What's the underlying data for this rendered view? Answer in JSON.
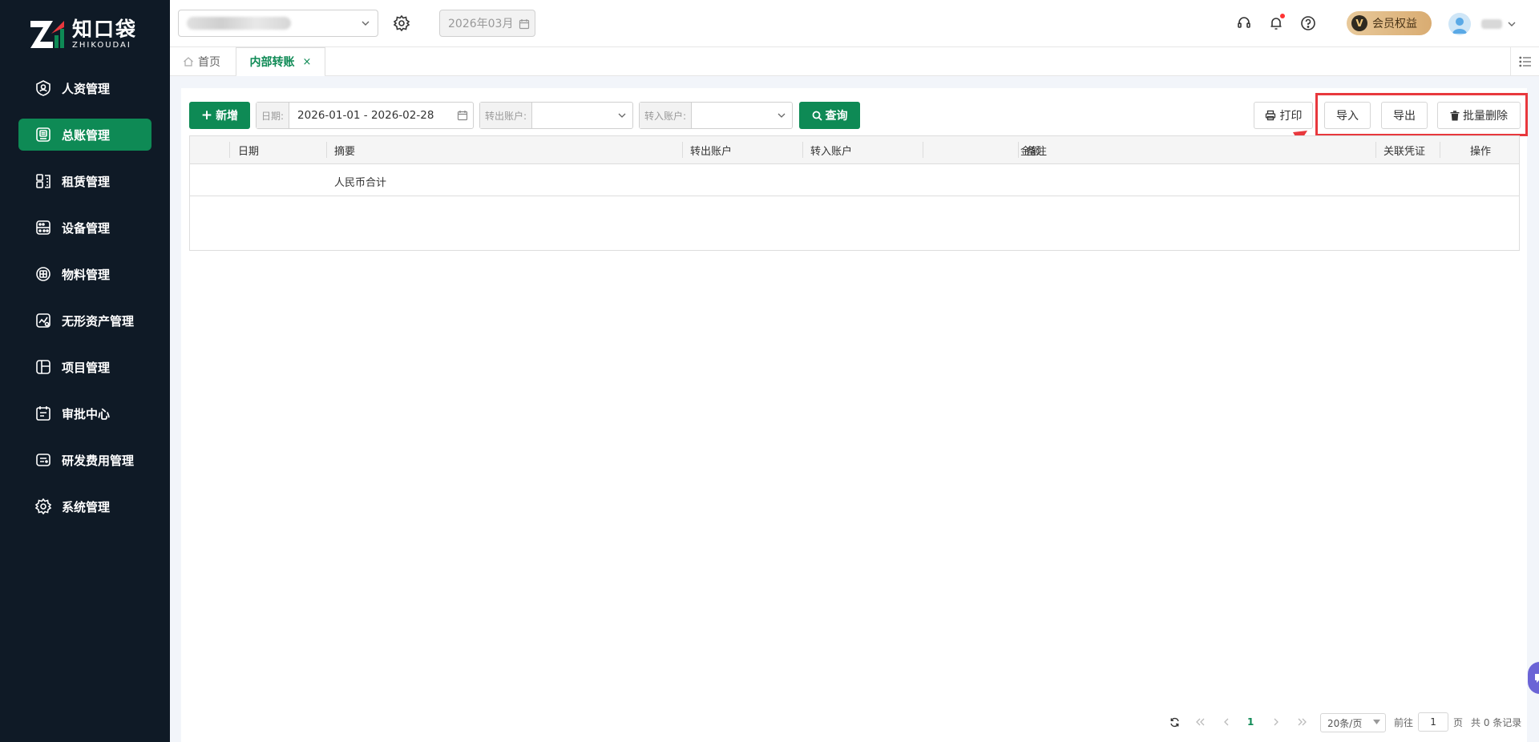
{
  "brand": {
    "name_cn": "知口袋",
    "name_en": "ZHIKOUDAI"
  },
  "sidebar": {
    "items": [
      {
        "label": "人资管理",
        "icon": "user-shield-icon",
        "active": false
      },
      {
        "label": "总账管理",
        "icon": "ledger-icon",
        "active": true
      },
      {
        "label": "租赁管理",
        "icon": "lease-icon",
        "active": false
      },
      {
        "label": "设备管理",
        "icon": "device-icon",
        "active": false
      },
      {
        "label": "物料管理",
        "icon": "materials-icon",
        "active": false
      },
      {
        "label": "无形资产管理",
        "icon": "intangible-asset-icon",
        "active": false
      },
      {
        "label": "项目管理",
        "icon": "project-icon",
        "active": false
      },
      {
        "label": "审批中心",
        "icon": "approval-icon",
        "active": false
      },
      {
        "label": "研发费用管理",
        "icon": "rd-expense-icon",
        "active": false
      },
      {
        "label": "系统管理",
        "icon": "gear-icon",
        "active": false
      }
    ]
  },
  "topbar": {
    "period": "2026年03月",
    "vip_label": "会员权益",
    "vip_badge": "V"
  },
  "tabs": {
    "home": "首页",
    "active": "内部转账",
    "close": "×"
  },
  "toolbar": {
    "add_label": "新增",
    "date_label": "日期:",
    "date_value": "2026-01-01 - 2026-02-28",
    "out_account_label": "转出账户:",
    "in_account_label": "转入账户:",
    "query_label": "查询",
    "print_label": "打印",
    "import_label": "导入",
    "export_label": "导出",
    "batch_delete_label": "批量删除"
  },
  "table": {
    "columns": [
      "日期",
      "摘要",
      "转出账户",
      "转入账户",
      "金额",
      "备注",
      "关联凭证",
      "操作"
    ],
    "summary_label": "人民币合计"
  },
  "pagination": {
    "current_page": "1",
    "page_size": "20条/页",
    "goto_label": "前往",
    "goto_value": "1",
    "page_unit": "页",
    "total": "共 0 条记录"
  },
  "colors": {
    "sidebar_bg": "#0f1a26",
    "accent_green": "#0e8a55",
    "highlight_red": "#e8383d"
  }
}
